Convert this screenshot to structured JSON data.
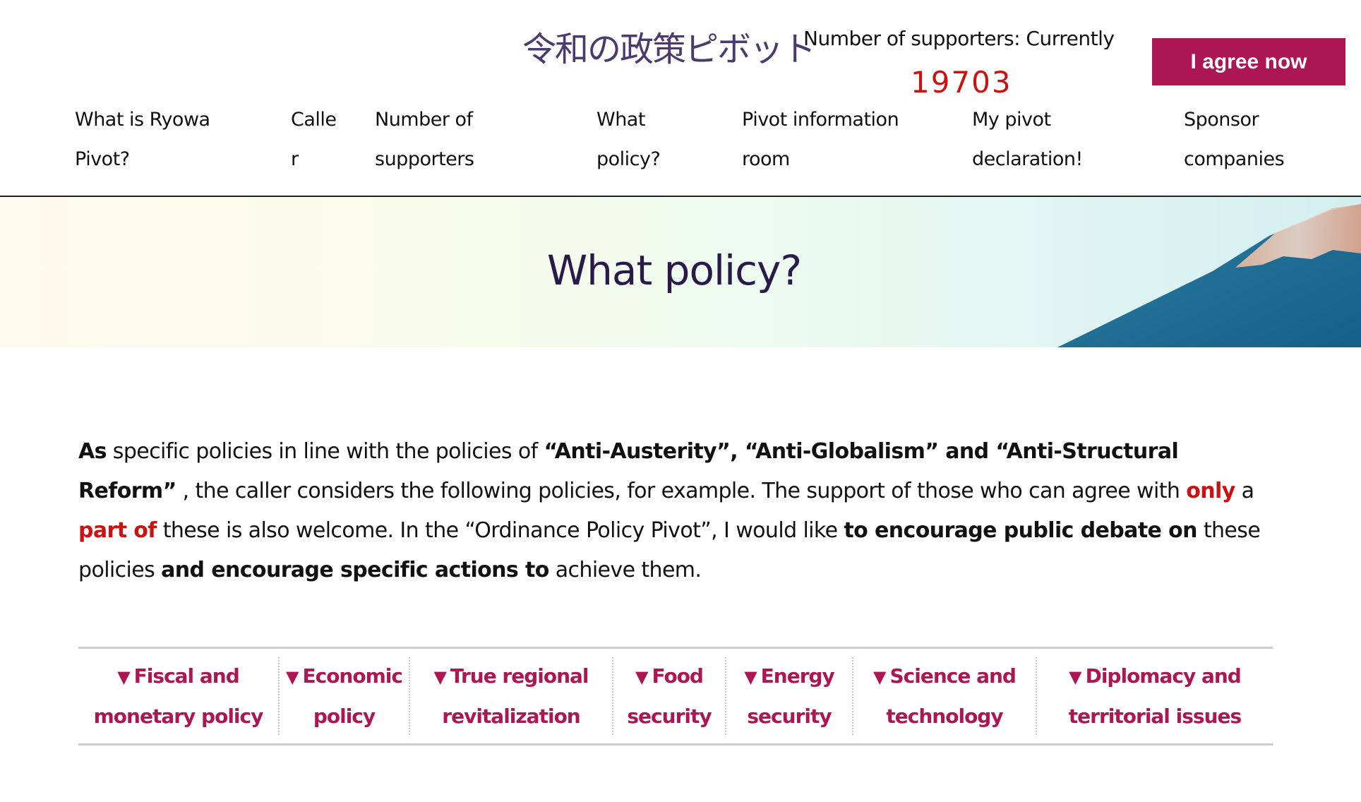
{
  "header": {
    "logo_text": "令和の政策ピボット",
    "supporters_label": "Number of supporters: Currently",
    "supporters_count": "19703",
    "agree_button": "I agree now"
  },
  "nav": {
    "items": [
      {
        "line1": "What is Ryowa",
        "line2": "Pivot?"
      },
      {
        "line1": "Calle",
        "line2": "r"
      },
      {
        "line1": "Number of",
        "line2": "supporters"
      },
      {
        "line1": "What",
        "line2": "policy?"
      },
      {
        "line1": "Pivot information",
        "line2": "room"
      },
      {
        "line1": "My pivot",
        "line2": "declaration!"
      },
      {
        "line1": "Sponsor",
        "line2": "companies"
      }
    ]
  },
  "hero": {
    "title": "What policy?"
  },
  "intro": {
    "segments": [
      {
        "text": "As",
        "style": "bold"
      },
      {
        "text": " specific policies in line with the policies of ",
        "style": "normal"
      },
      {
        "text": "“Anti-Austerity”, “Anti-Globalism” and “Anti-Structural Reform”",
        "style": "bold"
      },
      {
        "text": " , the caller considers the following policies, for example. The support of those who can agree with ",
        "style": "normal"
      },
      {
        "text": "only",
        "style": "red"
      },
      {
        "text": " a ",
        "style": "normal"
      },
      {
        "text": "part of",
        "style": "red"
      },
      {
        "text": " these is also welcome. In the “Ordinance Policy Pivot”, I would like ",
        "style": "normal"
      },
      {
        "text": "to encourage public debate on",
        "style": "bold"
      },
      {
        "text": " these policies ",
        "style": "normal"
      },
      {
        "text": "and encourage specific actions to",
        "style": "bold"
      },
      {
        "text": " achieve them.",
        "style": "normal"
      }
    ]
  },
  "policy_links": {
    "marker_icon": "▼",
    "items": [
      {
        "line1": "Fiscal and",
        "line2": "monetary policy"
      },
      {
        "line1": "Economic",
        "line2": "policy"
      },
      {
        "line1": "True regional",
        "line2": "revitalization"
      },
      {
        "line1": "Food",
        "line2": "security"
      },
      {
        "line1": "Energy",
        "line2": "security"
      },
      {
        "line1": "Science and",
        "line2": "technology"
      },
      {
        "line1": "Diplomacy and",
        "line2": "territorial issues"
      }
    ]
  },
  "colors": {
    "accent": "#ab1653",
    "count_red": "#cc1111",
    "title": "#2a1a4a"
  }
}
